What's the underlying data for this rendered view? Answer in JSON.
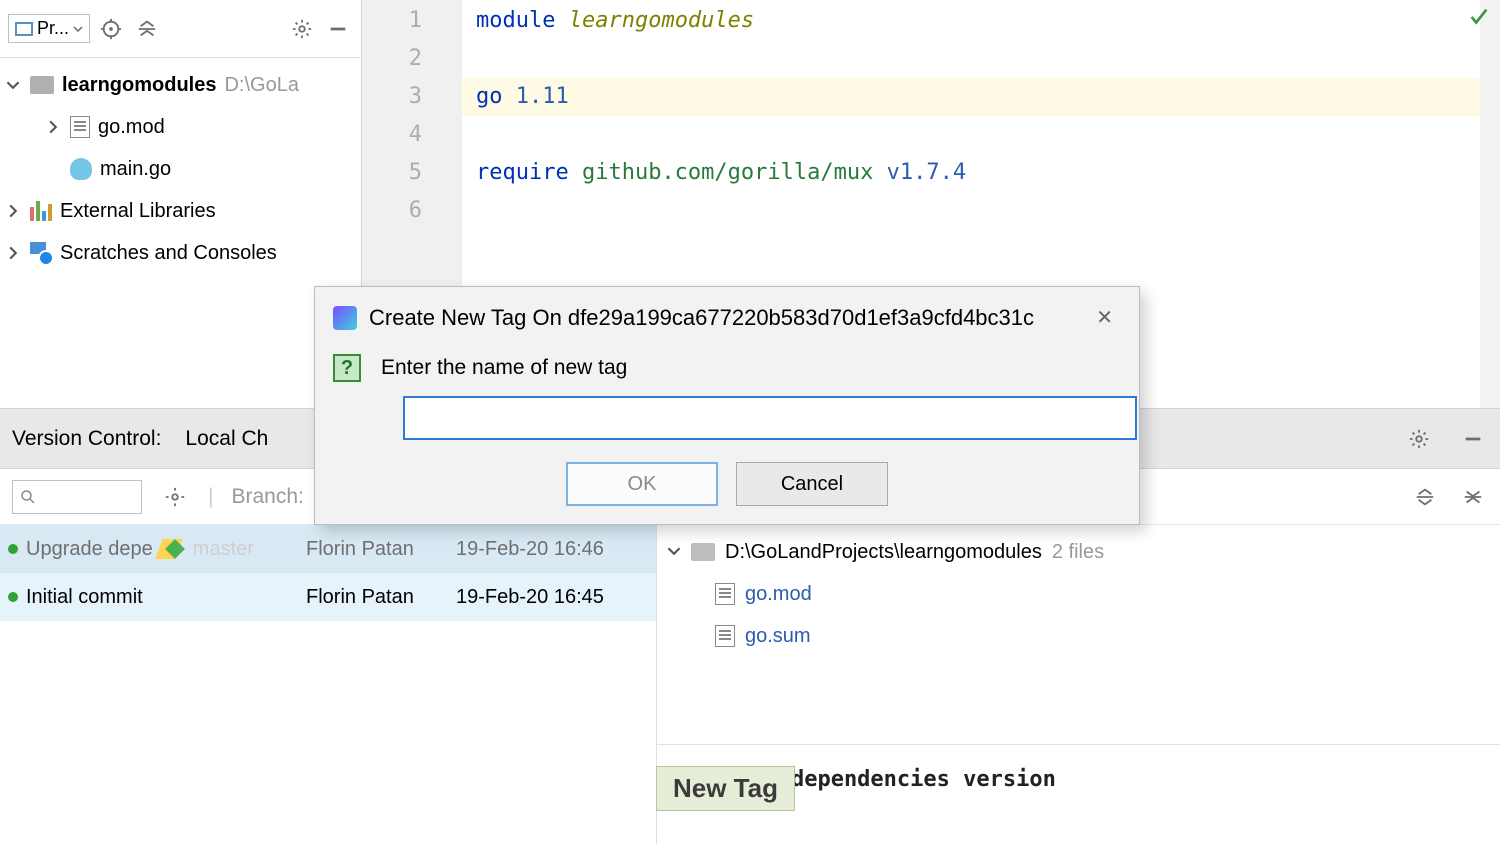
{
  "project": {
    "combo_label": "Pr...",
    "root": "learngomodules",
    "root_path": "D:\\GoLa",
    "files": [
      "go.mod",
      "main.go"
    ],
    "external_libs": "External Libraries",
    "scratches": "Scratches and Consoles"
  },
  "editor": {
    "lines": [
      "1",
      "2",
      "3",
      "4",
      "5",
      "6"
    ],
    "l1_kw": "module",
    "l1_name": " learngomodules",
    "l3_kw": "go",
    "l3_ver": " 1.11",
    "l5_kw": "require",
    "l5_pkg": " github.com/gorilla/mux",
    "l5_ver": " v1.7.4"
  },
  "vc": {
    "header": "Version Control:",
    "tab": "Local Ch",
    "branch_label": "Branch:"
  },
  "commits": [
    {
      "msg": "Upgrade depe",
      "branch": "master",
      "author": "Florin Patan",
      "date": "19-Feb-20 16:46"
    },
    {
      "msg": "Initial commit",
      "branch": "",
      "author": "Florin Patan",
      "date": "19-Feb-20 16:45"
    }
  ],
  "detail": {
    "path": "D:\\GoLandProjects\\learngomodules",
    "count": "2 files",
    "files": [
      "go.mod",
      "go.sum"
    ],
    "commit_msg": "Upgrade dependencies version"
  },
  "dialog": {
    "title": "Create New Tag On dfe29a199ca677220b583d70d1ef3a9cfd4bc31c",
    "prompt": "Enter the name of new tag",
    "ok": "OK",
    "cancel": "Cancel"
  },
  "tooltip": "New Tag"
}
